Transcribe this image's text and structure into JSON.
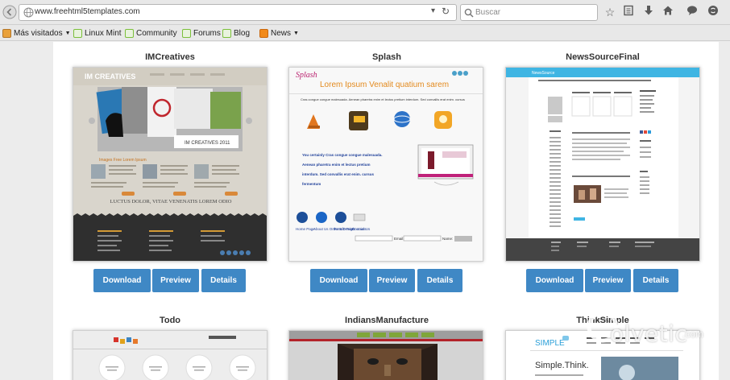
{
  "browser": {
    "url": "www.freehtml5templates.com",
    "search_placeholder": "Buscar"
  },
  "bookmarks": [
    {
      "label": "Más visitados",
      "icon": "folder-icon",
      "dropdown": true
    },
    {
      "label": "Linux Mint",
      "icon": "mint-icon",
      "dropdown": false
    },
    {
      "label": "Community",
      "icon": "mint-icon",
      "dropdown": false
    },
    {
      "label": "Forums",
      "icon": "mint-icon",
      "dropdown": false
    },
    {
      "label": "Blog",
      "icon": "mint-icon",
      "dropdown": false
    },
    {
      "label": "News",
      "icon": "rss-icon",
      "dropdown": true
    }
  ],
  "buttons": {
    "download": "Download",
    "preview": "Preview",
    "details": "Details"
  },
  "templates": [
    {
      "title": "IMCreatives"
    },
    {
      "title": "Splash"
    },
    {
      "title": "NewsSourceFinal"
    },
    {
      "title": "Todo"
    },
    {
      "title": "IndiansManufacture"
    },
    {
      "title": "ThinkSimple"
    }
  ],
  "previews": {
    "imcreatives": {
      "logo": "IM CREATIVES",
      "banner": "IM CREATIVES 2011",
      "col_title": "Images Free Lorem Ipsum",
      "slogan": "LUCTUS DOLOR, VITAE VENENATIS LOREM ODIO"
    },
    "splash": {
      "logo": "Splash",
      "headline": "Lorem Ipsum Venalit quatium sarem",
      "tagline": "Cras congue congue malesuada. Aenean pharetra enim et lectus pretium interdum. Sed convallis erat enim. cursus",
      "body_lines": [
        "You certainly Cras congue congue malesuada.",
        "Aenean pharetra enim et lectus pretium",
        "interdum. Sed convallis erat enim. cursus",
        "fermentum"
      ],
      "icon_labels": [
        "Home Page",
        "About Us Order & Design",
        "Portafo Testimonials",
        "Contact Us"
      ],
      "form_labels": [
        "Email:",
        "Name:"
      ]
    },
    "newssource": {
      "logo": "NewsSource"
    },
    "thinksimple": {
      "logo": "SIMPLE",
      "headline": "Simple.Think."
    }
  },
  "watermark": {
    "brand": "olvetic",
    "suffix": ".com"
  }
}
